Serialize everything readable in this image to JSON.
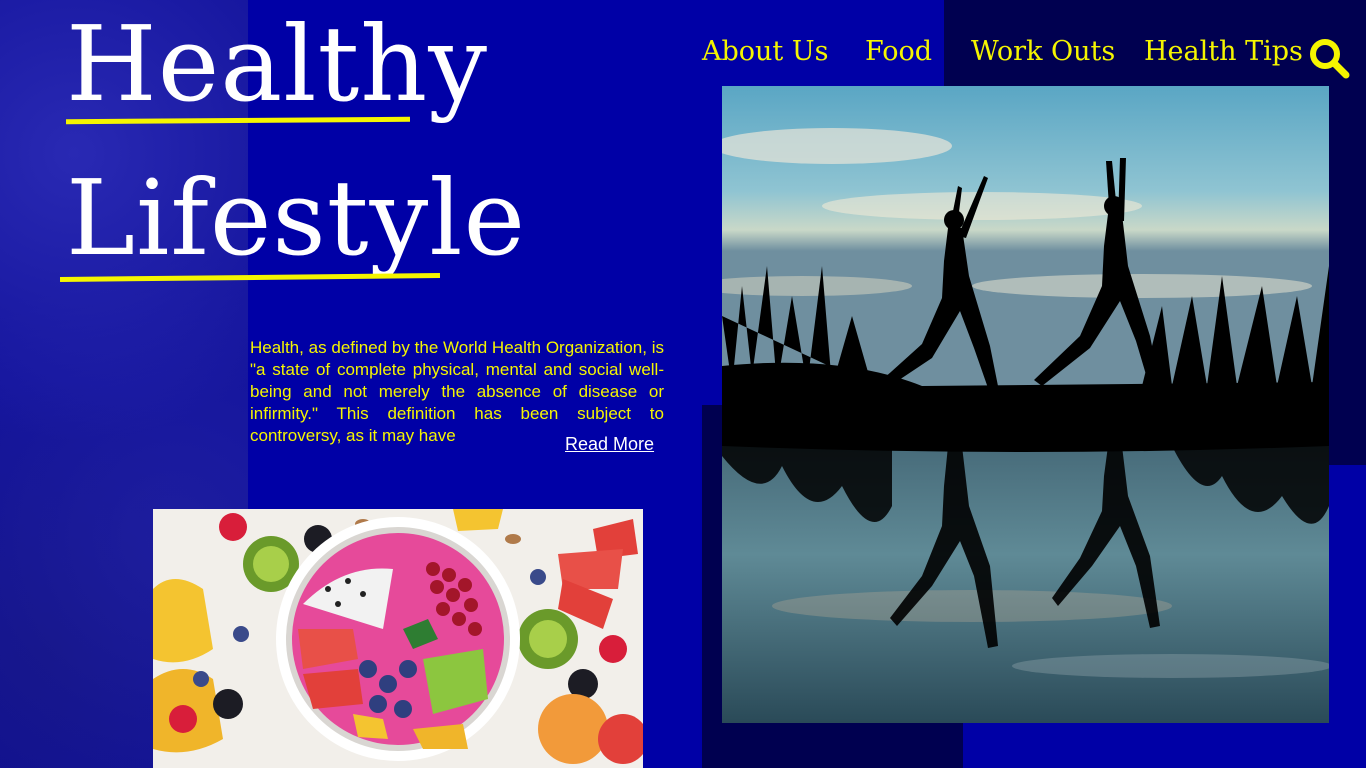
{
  "brand": {
    "title_line1": "Healthy",
    "title_line2": "Lifestyle",
    "accent_color": "#f5f500",
    "background_color": "#0000a6",
    "dark_panel_color": "#000050"
  },
  "nav": {
    "items": [
      {
        "label": "About Us"
      },
      {
        "label": "Food"
      },
      {
        "label": "Work Outs"
      },
      {
        "label": "Health Tips"
      }
    ],
    "search_icon": "search-icon"
  },
  "intro": {
    "text": "Health, as defined by the World Health Organization, is \"a state of complete physical, mental and social well-being and not merely the absence of disease or infirmity.\" This definition has been subject to controversy, as it may have",
    "read_more": "Read More"
  }
}
